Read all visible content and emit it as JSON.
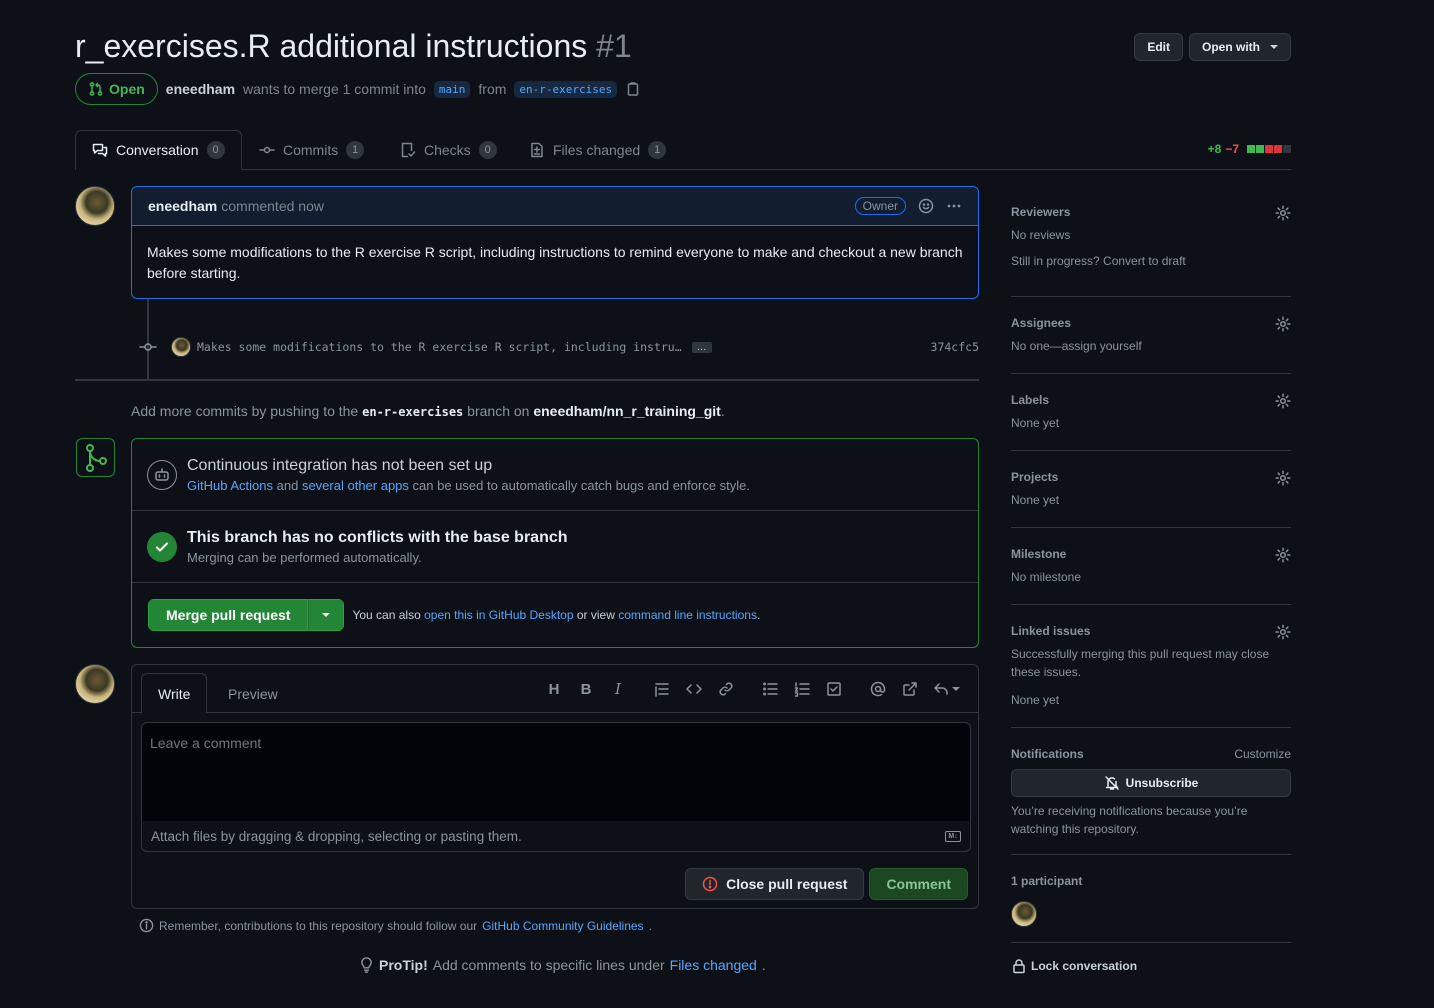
{
  "pr": {
    "title": "r_exercises.R additional instructions",
    "number": "#1",
    "edit_label": "Edit",
    "open_with_label": "Open with",
    "state": "Open",
    "author": "eneedham",
    "merge_text": "wants to merge 1 commit into",
    "base_branch": "main",
    "from_text": "from",
    "head_branch": "en-r-exercises"
  },
  "tabs": [
    {
      "label": "Conversation",
      "count": "0"
    },
    {
      "label": "Commits",
      "count": "1"
    },
    {
      "label": "Checks",
      "count": "0"
    },
    {
      "label": "Files changed",
      "count": "1"
    }
  ],
  "diffstat": {
    "additions": "+8",
    "deletions": "−7",
    "add_color": "#3fb950",
    "del_color": "#da3633",
    "neutral_color": "#30363d"
  },
  "comment": {
    "author": "eneedham",
    "time": "commented now",
    "badge": "Owner",
    "body": "Makes some modifications to the R exercise R script, including instructions to remind everyone to make and checkout a new branch before starting."
  },
  "commit": {
    "message": "Makes some modifications to the R exercise R script, including instru…",
    "ellipsis": "…",
    "sha": "374cfc5"
  },
  "push_hint": {
    "prefix": "Add more commits by pushing to the",
    "branch": "en-r-exercises",
    "middle": "branch on",
    "repo": "eneedham/nn_r_training_git",
    "suffix": "."
  },
  "merge": {
    "ci_title": "Continuous integration has not been set up",
    "ci_link1": "GitHub Actions",
    "ci_and": "and",
    "ci_link2": "several other apps",
    "ci_rest": "can be used to automatically catch bugs and enforce style.",
    "conflict_title": "This branch has no conflicts with the base branch",
    "conflict_sub": "Merging can be performed automatically.",
    "merge_button": "Merge pull request",
    "also_text": "You can also",
    "desktop_link": "open this in GitHub Desktop",
    "or_view": "or view",
    "cli_link": "command line instructions",
    "period": "."
  },
  "editor": {
    "write_tab": "Write",
    "preview_tab": "Preview",
    "toolbar": [
      "heading-icon",
      "bold-icon",
      "italic-icon",
      "quote-icon",
      "code-icon",
      "link-icon",
      "bullet-list-icon",
      "numbered-list-icon",
      "task-list-icon",
      "mention-icon",
      "cross-reference-icon",
      "reply-icon"
    ],
    "heading_glyph": "H",
    "bold_glyph": "B",
    "italic_glyph": "I",
    "placeholder": "Leave a comment",
    "attach_text": "Attach files by dragging & dropping, selecting or pasting them.",
    "close_button": "Close pull request",
    "comment_button": "Comment"
  },
  "footer": {
    "remember_prefix": "Remember, contributions to this repository should follow our",
    "remember_link": "GitHub Community Guidelines",
    "remember_suffix": ".",
    "protip_label": "ProTip!",
    "protip_text": "Add comments to specific lines under",
    "protip_link": "Files changed",
    "protip_suffix": "."
  },
  "sidebar": {
    "reviewers": {
      "title": "Reviewers",
      "value": "No reviews",
      "extra": "Still in progress? Convert to draft"
    },
    "assignees": {
      "title": "Assignees",
      "value": "No one—assign yourself"
    },
    "labels": {
      "title": "Labels",
      "value": "None yet"
    },
    "projects": {
      "title": "Projects",
      "value": "None yet"
    },
    "milestone": {
      "title": "Milestone",
      "value": "No milestone"
    },
    "linked": {
      "title": "Linked issues",
      "desc": "Successfully merging this pull request may close these issues.",
      "value": "None yet"
    },
    "notifications": {
      "title": "Notifications",
      "customize": "Customize",
      "button": "Unsubscribe",
      "desc": "You’re receiving notifications because you’re watching this repository."
    },
    "participants": {
      "title": "1 participant"
    },
    "lock": "Lock conversation"
  }
}
